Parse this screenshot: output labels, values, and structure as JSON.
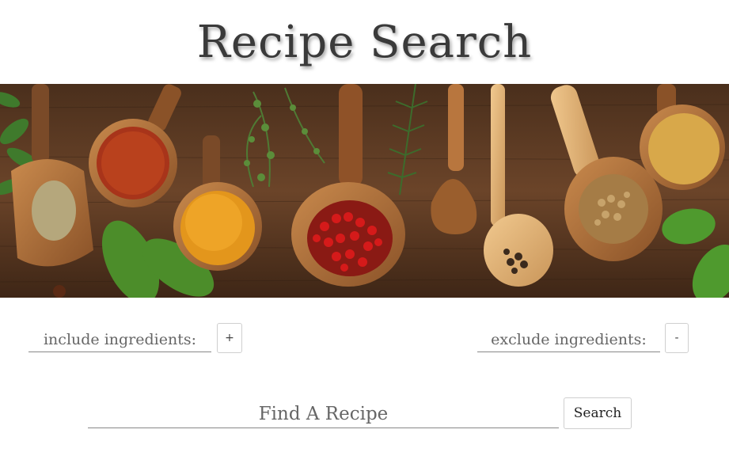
{
  "page": {
    "title": "Recipe Search"
  },
  "banner": {
    "image": "spices-in-wooden-spoons-photo"
  },
  "include": {
    "placeholder": "include ingredients:",
    "button_label": "+"
  },
  "exclude": {
    "placeholder": "exclude ingredients:",
    "button_label": "-"
  },
  "search": {
    "placeholder": "Find A Recipe",
    "button_label": "Search"
  }
}
